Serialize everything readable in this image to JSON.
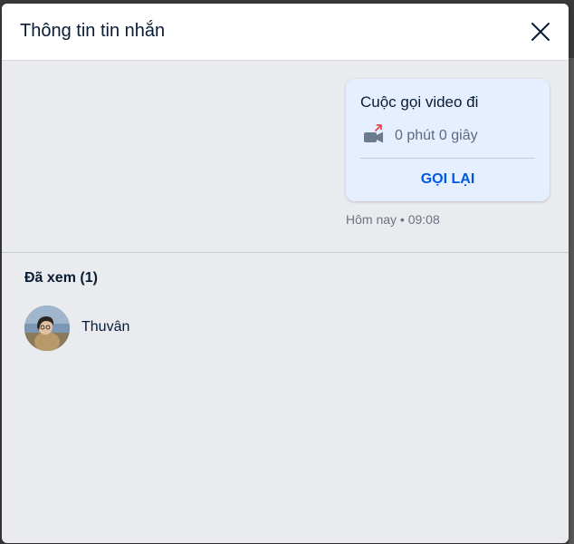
{
  "dialog": {
    "title": "Thông tin tin nhắn",
    "close_icon": "close-icon"
  },
  "message": {
    "title": "Cuộc gọi video đi",
    "icon": "outgoing-video-call-icon",
    "duration": "0 phút 0 giây",
    "callback_label": "GỌI LẠI",
    "timestamp": "Hôm nay • 09:08",
    "bubble_color": "#e5efff",
    "callback_color": "#005ae0",
    "outgoing_arrow_color": "#e5484d"
  },
  "seen": {
    "title": "Đã xem (1)",
    "users": [
      {
        "name": "Thuvân",
        "avatar": "avatar-photo"
      }
    ]
  }
}
